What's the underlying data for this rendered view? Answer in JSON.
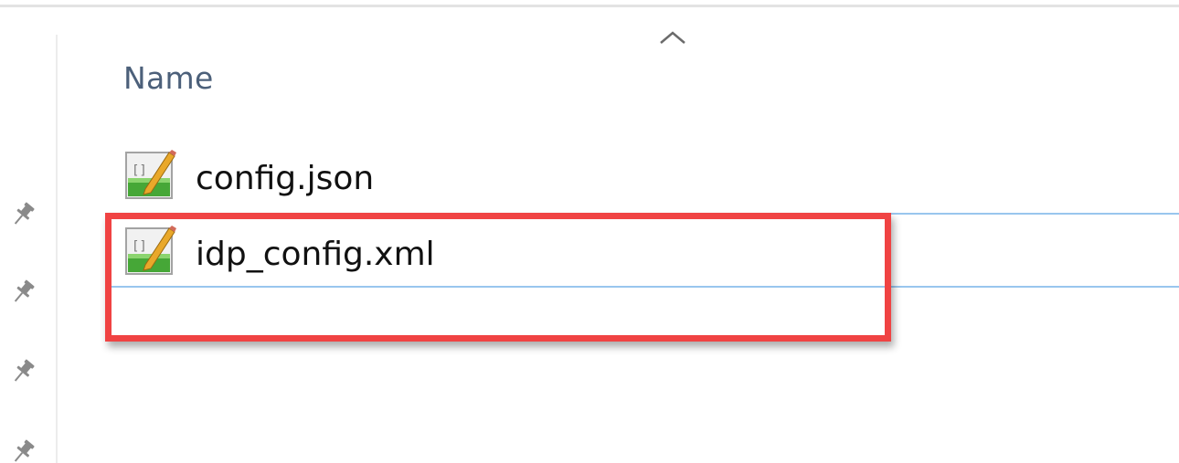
{
  "file_list": {
    "column_header": "Name",
    "sort_indicator_icon": "chevron-up-icon",
    "files": [
      {
        "name": "config.json",
        "icon": "text-file-icon"
      },
      {
        "name": "idp_config.xml",
        "icon": "text-file-icon",
        "selected": true
      }
    ]
  },
  "quick_access": {
    "pin_icon": "pin-icon",
    "pin_count": 4
  },
  "colors": {
    "highlight_border": "#f04343",
    "selection_line": "#99c6ee",
    "header_text": "#4c607a"
  }
}
